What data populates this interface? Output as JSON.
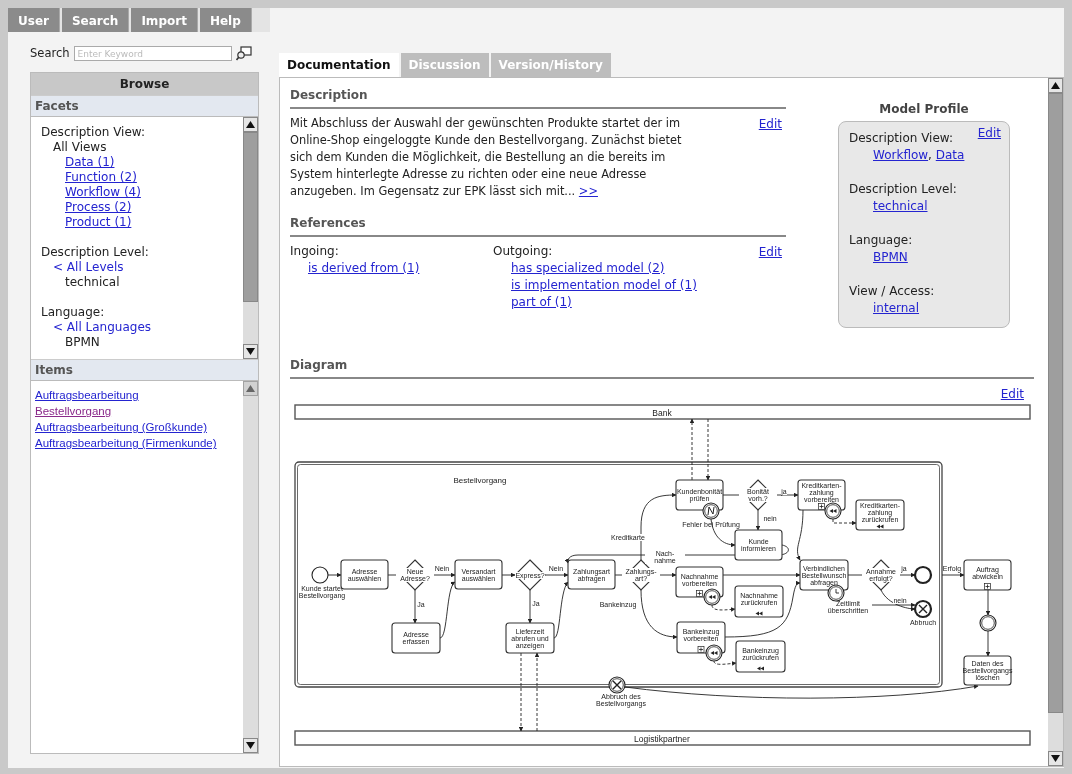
{
  "menu": [
    {
      "label": "User"
    },
    {
      "label": "Search"
    },
    {
      "label": "Import"
    },
    {
      "label": "Help"
    }
  ],
  "search": {
    "label": "Search",
    "placeholder": "Enter Keyword"
  },
  "browse": {
    "title": "Browse",
    "facets_title": "Facets",
    "facets": [
      {
        "heading": "Description View:",
        "entries": [
          {
            "text": "All Views",
            "kind": "current",
            "children": [
              {
                "text": "Data (1)",
                "kind": "link"
              },
              {
                "text": "Function (2)",
                "kind": "link"
              },
              {
                "text": "Workflow (4)",
                "kind": "link"
              },
              {
                "text": "Process (2)",
                "kind": "link"
              },
              {
                "text": "Product (1)",
                "kind": "link"
              }
            ]
          }
        ]
      },
      {
        "heading": "Description Level:",
        "entries": [
          {
            "text": "< All Levels",
            "kind": "up",
            "children": [
              {
                "text": "technical",
                "kind": "current"
              }
            ]
          }
        ]
      },
      {
        "heading": "Language:",
        "entries": [
          {
            "text": "< All Languages",
            "kind": "up",
            "children": [
              {
                "text": "BPMN",
                "kind": "current"
              }
            ]
          }
        ]
      }
    ],
    "items_title": "Items",
    "items": [
      {
        "text": "Auftragsbearbeitung",
        "visited": false
      },
      {
        "text": "Bestellvorgang",
        "visited": true
      },
      {
        "text": "Auftragsbearbeitung (Großkunde)",
        "visited": false
      },
      {
        "text": "Auftragsbearbeitung (Firmenkunde)",
        "visited": false
      }
    ]
  },
  "tabs": [
    {
      "label": "Documentation",
      "selected": true
    },
    {
      "label": "Discussion",
      "selected": false
    },
    {
      "label": "Version/History",
      "selected": false
    }
  ],
  "description": {
    "title": "Description",
    "edit": "Edit",
    "text": "Mit Abschluss der Auswahl der gewünschten Produkte startet der im Online-Shop eingeloggte Kunde den Bestellvorgang. Zunächst bietet sich dem Kunden die Möglichkeit, die Bestellung an die bereits im System hinterlegte Adresse zu richten oder eine neue Adresse anzugeben. Im Gegensatz zur EPK lässt sich mit...",
    "more": ">>"
  },
  "references": {
    "title": "References",
    "edit": "Edit",
    "groups": [
      {
        "label": "Ingoing:",
        "links": [
          "is derived from (1)"
        ]
      },
      {
        "label": "Outgoing:",
        "links": [
          "has specialized model (2)",
          "is implementation model of (1)",
          "part of (1)"
        ]
      }
    ]
  },
  "model_profile": {
    "title": "Model Profile",
    "edit": "Edit",
    "fields": [
      {
        "label": "Description View:",
        "values": [
          {
            "text": "Workflow",
            "sep": ","
          },
          {
            "text": "Data"
          }
        ]
      },
      {
        "label": "Description Level:",
        "values": [
          {
            "text": "technical"
          }
        ]
      },
      {
        "label": "Language:",
        "values": [
          {
            "text": "BPMN"
          }
        ]
      },
      {
        "label": "View / Access:",
        "values": [
          {
            "text": "internal"
          }
        ]
      }
    ]
  },
  "diagram": {
    "title": "Diagram",
    "edit": "Edit",
    "pools": [
      "Bank",
      "Logistikpartner"
    ],
    "subprocess": "Bestellvorgang",
    "nodes": [
      {
        "kind": "start",
        "label": "Kunde startet Bestellvorgang"
      },
      {
        "kind": "task",
        "label": "Adresse auswählen"
      },
      {
        "kind": "gateway",
        "label": "Neue Adresse?"
      },
      {
        "kind": "task",
        "label": "Adresse erfassen"
      },
      {
        "kind": "task",
        "label": "Versandart auswählen"
      },
      {
        "kind": "gateway",
        "label": "Express?"
      },
      {
        "kind": "task",
        "label": "Lieferzeit abrufen und anzeigen"
      },
      {
        "kind": "task",
        "label": "Zahlungsart abfragen"
      },
      {
        "kind": "gateway",
        "label": "Zahlungs-art?"
      },
      {
        "kind": "task",
        "label": "Kundenbonität prüfen"
      },
      {
        "kind": "error_boundary",
        "label": "Fehler bei Prüfung"
      },
      {
        "kind": "gateway",
        "label": "Bonität vorh.?"
      },
      {
        "kind": "task",
        "label": "Kunde informieren"
      },
      {
        "kind": "task",
        "label": "Kreditkarten-zahlung vorbereiten",
        "collapsed": true,
        "compensation": false
      },
      {
        "kind": "compensation_boundary"
      },
      {
        "kind": "task",
        "label": "Kreditkarten-zahlung zurückrufen",
        "collapsed": false,
        "compensation": true
      },
      {
        "kind": "task",
        "label": "Nachnahme vorbereiten",
        "collapsed": true,
        "compensation": false
      },
      {
        "kind": "compensation_boundary"
      },
      {
        "kind": "task",
        "label": "Nachnahme zurückrufen",
        "collapsed": false,
        "compensation": true
      },
      {
        "kind": "task",
        "label": "Bankeinzug vorbereiten",
        "collapsed": true,
        "compensation": false
      },
      {
        "kind": "compensation_boundary"
      },
      {
        "kind": "task",
        "label": "Bankeinzug zurückrufen",
        "collapsed": false,
        "compensation": true
      },
      {
        "kind": "task",
        "label": "Verbindlichen Bestellwunsch abfragen"
      },
      {
        "kind": "timer_boundary",
        "label": "Zeitlimit überschritten"
      },
      {
        "kind": "gateway",
        "label": "Annahme erfolgt?"
      },
      {
        "kind": "end"
      },
      {
        "kind": "cancel_end",
        "label": "Abbruch"
      },
      {
        "kind": "cancel_boundary",
        "label": "Abbruch des Bestellvorgangs"
      },
      {
        "kind": "task",
        "label": "Auftrag abwickeln",
        "collapsed": true,
        "compensation": false
      },
      {
        "kind": "intermediate"
      },
      {
        "kind": "task",
        "label": "Daten des Bestellvorgangs löschen"
      }
    ],
    "flow_labels": [
      "Nein",
      "Ja",
      "Nein",
      "Ja",
      "Kreditkarte",
      "Nach-nahme",
      "Bankeinzug",
      "ja",
      "nein",
      "ja",
      "nein",
      "Erfolg"
    ]
  }
}
